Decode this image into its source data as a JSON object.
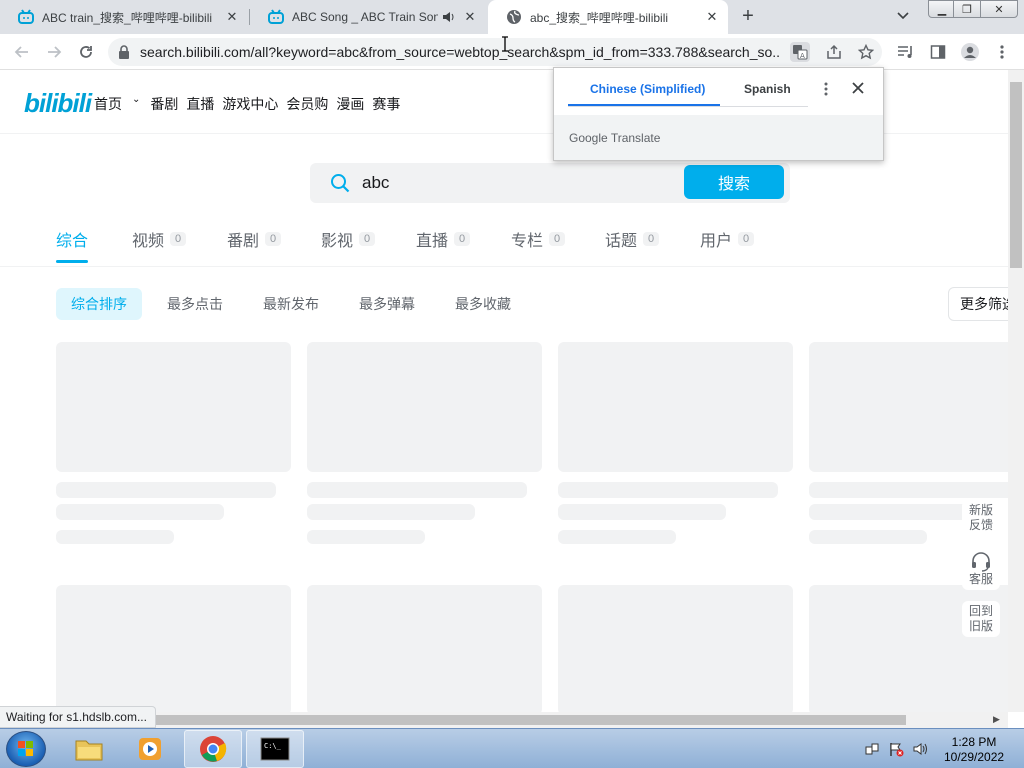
{
  "browser": {
    "tabs": [
      {
        "title": "ABC train_搜索_哔哩哔哩-bilibili",
        "active": false
      },
      {
        "title": "ABC Song _ ABC Train Song",
        "active": false,
        "audio": true
      },
      {
        "title": "abc_搜索_哔哩哔哩-bilibili",
        "active": true
      }
    ],
    "url": "search.bilibili.com/all?keyword=abc&from_source=webtop_search&spm_id_from=333.788&search_so...",
    "status_text": "Waiting for s1.hdslb.com..."
  },
  "translate_popup": {
    "languages": [
      "Chinese (Simplified)",
      "Spanish"
    ],
    "selected": "Chinese (Simplified)",
    "footer": "Google Translate"
  },
  "site": {
    "logo": "bilibili",
    "nav": [
      "首页",
      "番剧",
      "直播",
      "游戏中心",
      "会员购",
      "漫画",
      "赛事"
    ],
    "search": {
      "value": "abc",
      "button": "搜索"
    },
    "categories": [
      {
        "label": "综合",
        "count": ""
      },
      {
        "label": "视频",
        "count": "0"
      },
      {
        "label": "番剧",
        "count": "0"
      },
      {
        "label": "影视",
        "count": "0"
      },
      {
        "label": "直播",
        "count": "0"
      },
      {
        "label": "专栏",
        "count": "0"
      },
      {
        "label": "话题",
        "count": "0"
      },
      {
        "label": "用户",
        "count": "0"
      }
    ],
    "sort_options": [
      "综合排序",
      "最多点击",
      "最新发布",
      "最多弹幕",
      "最多收藏"
    ],
    "more_filters": "更多筛选",
    "float_buttons": {
      "feedback": [
        "新版",
        "反馈"
      ],
      "service": "客服",
      "old_version": [
        "回到",
        "旧版"
      ]
    }
  },
  "taskbar": {
    "time": "1:28 PM",
    "date": "10/29/2022"
  },
  "colors": {
    "accent": "#00aeec",
    "chrome_accent": "#1a73e8"
  }
}
